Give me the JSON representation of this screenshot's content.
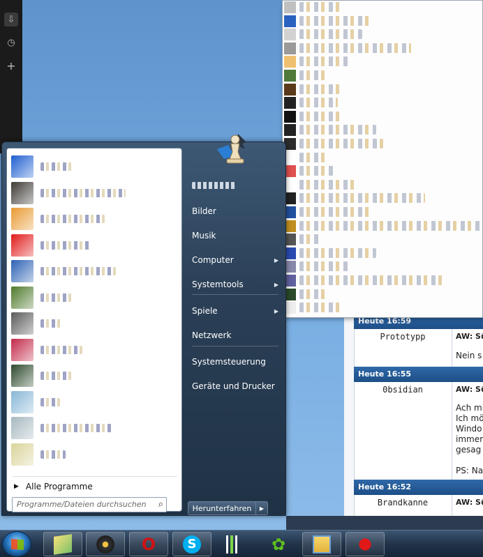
{
  "start_menu": {
    "right_items": [
      {
        "label": "Bilder",
        "submenu": false
      },
      {
        "label": "Musik",
        "submenu": false
      },
      {
        "label": "Computer",
        "submenu": true
      },
      {
        "label": "Systemtools",
        "submenu": true
      },
      {
        "label": "Spiele",
        "submenu": true
      },
      {
        "label": "Netzwerk",
        "submenu": false
      },
      {
        "label": "Systemsteuerung",
        "submenu": false
      },
      {
        "label": "Geräte und Drucker",
        "submenu": false
      }
    ],
    "all_programs_label": "Alle Programme",
    "search_placeholder": "Programme/Dateien durchsuchen",
    "shutdown_label": "Herunterfahren"
  },
  "forum": {
    "posts": [
      {
        "time": "Heute 16:59",
        "user": "Prototypp",
        "title": "AW: Sü",
        "text": [
          "Nein s"
        ]
      },
      {
        "time": "Heute 16:55",
        "user": "0bsidian",
        "title": "AW: Sü",
        "text": [
          "Ach mi",
          "Ich mö",
          "Windo",
          "immer",
          "gesag",
          "",
          "PS: Na"
        ]
      },
      {
        "time": "Heute 16:52",
        "user": "Brandkanne",
        "title": "AW: Sü",
        "text": []
      }
    ]
  },
  "taskbar": {
    "buttons": [
      {
        "icon": "windows-explorer-icon"
      },
      {
        "icon": "steam-like-icon"
      },
      {
        "icon": "opera-icon",
        "glyph": "O"
      },
      {
        "icon": "skype-icon",
        "glyph": "S"
      },
      {
        "icon": "app-bars-icon"
      },
      {
        "icon": "icq-flower-icon",
        "glyph": "✿"
      },
      {
        "icon": "folder-icon"
      },
      {
        "icon": "paint-splat-icon"
      }
    ]
  },
  "colors": {
    "accent": "#2f69a8",
    "taskbar": "#22344a",
    "opera_red": "#cc1414",
    "skype_blue": "#00aff0",
    "icq_green": "#5fbf1f"
  }
}
